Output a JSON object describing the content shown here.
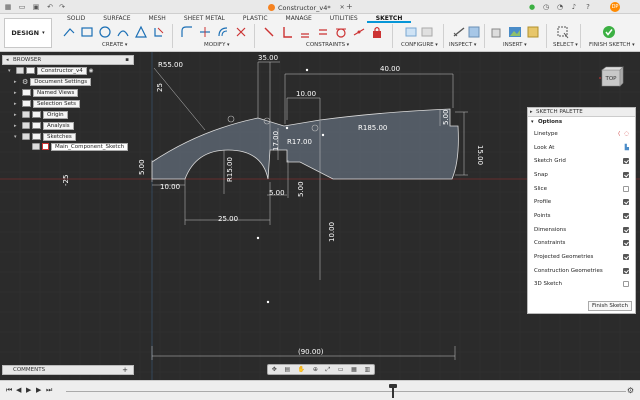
{
  "title_bar": {
    "document_title": "Constructor_v4*",
    "avatar_initials": "DP"
  },
  "ribbon": {
    "workspace_label": "DESIGN",
    "tabs": [
      "SOLID",
      "SURFACE",
      "MESH",
      "SHEET METAL",
      "PLASTIC",
      "MANAGE",
      "UTILITIES",
      "SKETCH"
    ],
    "active_tab": "SKETCH",
    "groups": {
      "create": "CREATE",
      "modify": "MODIFY",
      "constraints": "CONSTRAINTS",
      "configure": "CONFIGURE",
      "inspect": "INSPECT",
      "insert": "INSERT",
      "select": "SELECT",
      "finish": "FINISH SKETCH"
    }
  },
  "browser": {
    "header": "BROWSER",
    "root": "Constructor_v4",
    "items": [
      "Document Settings",
      "Named Views",
      "Selection Sets",
      "Origin",
      "Analysis",
      "Sketches"
    ],
    "sketch": "Main_Component_Sketch"
  },
  "palette": {
    "header": "SKETCH PALETTE",
    "section": "Options",
    "linetype_label": "Linetype",
    "look_at_label": "Look At",
    "options": [
      {
        "label": "Sketch Grid",
        "checked": true
      },
      {
        "label": "Snap",
        "checked": true
      },
      {
        "label": "Slice",
        "checked": false
      },
      {
        "label": "Profile",
        "checked": true
      },
      {
        "label": "Points",
        "checked": true
      },
      {
        "label": "Dimensions",
        "checked": true
      },
      {
        "label": "Constraints",
        "checked": true
      },
      {
        "label": "Projected Geometries",
        "checked": true
      },
      {
        "label": "Construction Geometries",
        "checked": true
      },
      {
        "label": "3D Sketch",
        "checked": false
      }
    ],
    "finish_button": "Finish Sketch"
  },
  "viewcube": {
    "face": "TOP"
  },
  "dimensions": {
    "r55": "R55.00",
    "d35": "35.00",
    "d40": "40.00",
    "d25_vert": "25",
    "d10_top": "10.00",
    "r185": "R185.00",
    "d5_right": "5.00",
    "d15": "15.00",
    "d17": "17.00",
    "r17": "R17.00",
    "d5_left": "5.00",
    "d10_bottom": "10.00",
    "r15": "R15.00",
    "d5_mid_h": "5.00",
    "d5_mid_v": "5.00",
    "d25_bottom": "25.00",
    "d10_vert": "10.00",
    "d90": "(90.00)",
    "axis_neg25": "-25"
  },
  "comments": {
    "label": "COMMENTS"
  },
  "colors": {
    "canvas": "#2b2b2b",
    "profile_fill": "#5a6470",
    "accent": "#0696d7",
    "finish_green": "#3cb043"
  }
}
